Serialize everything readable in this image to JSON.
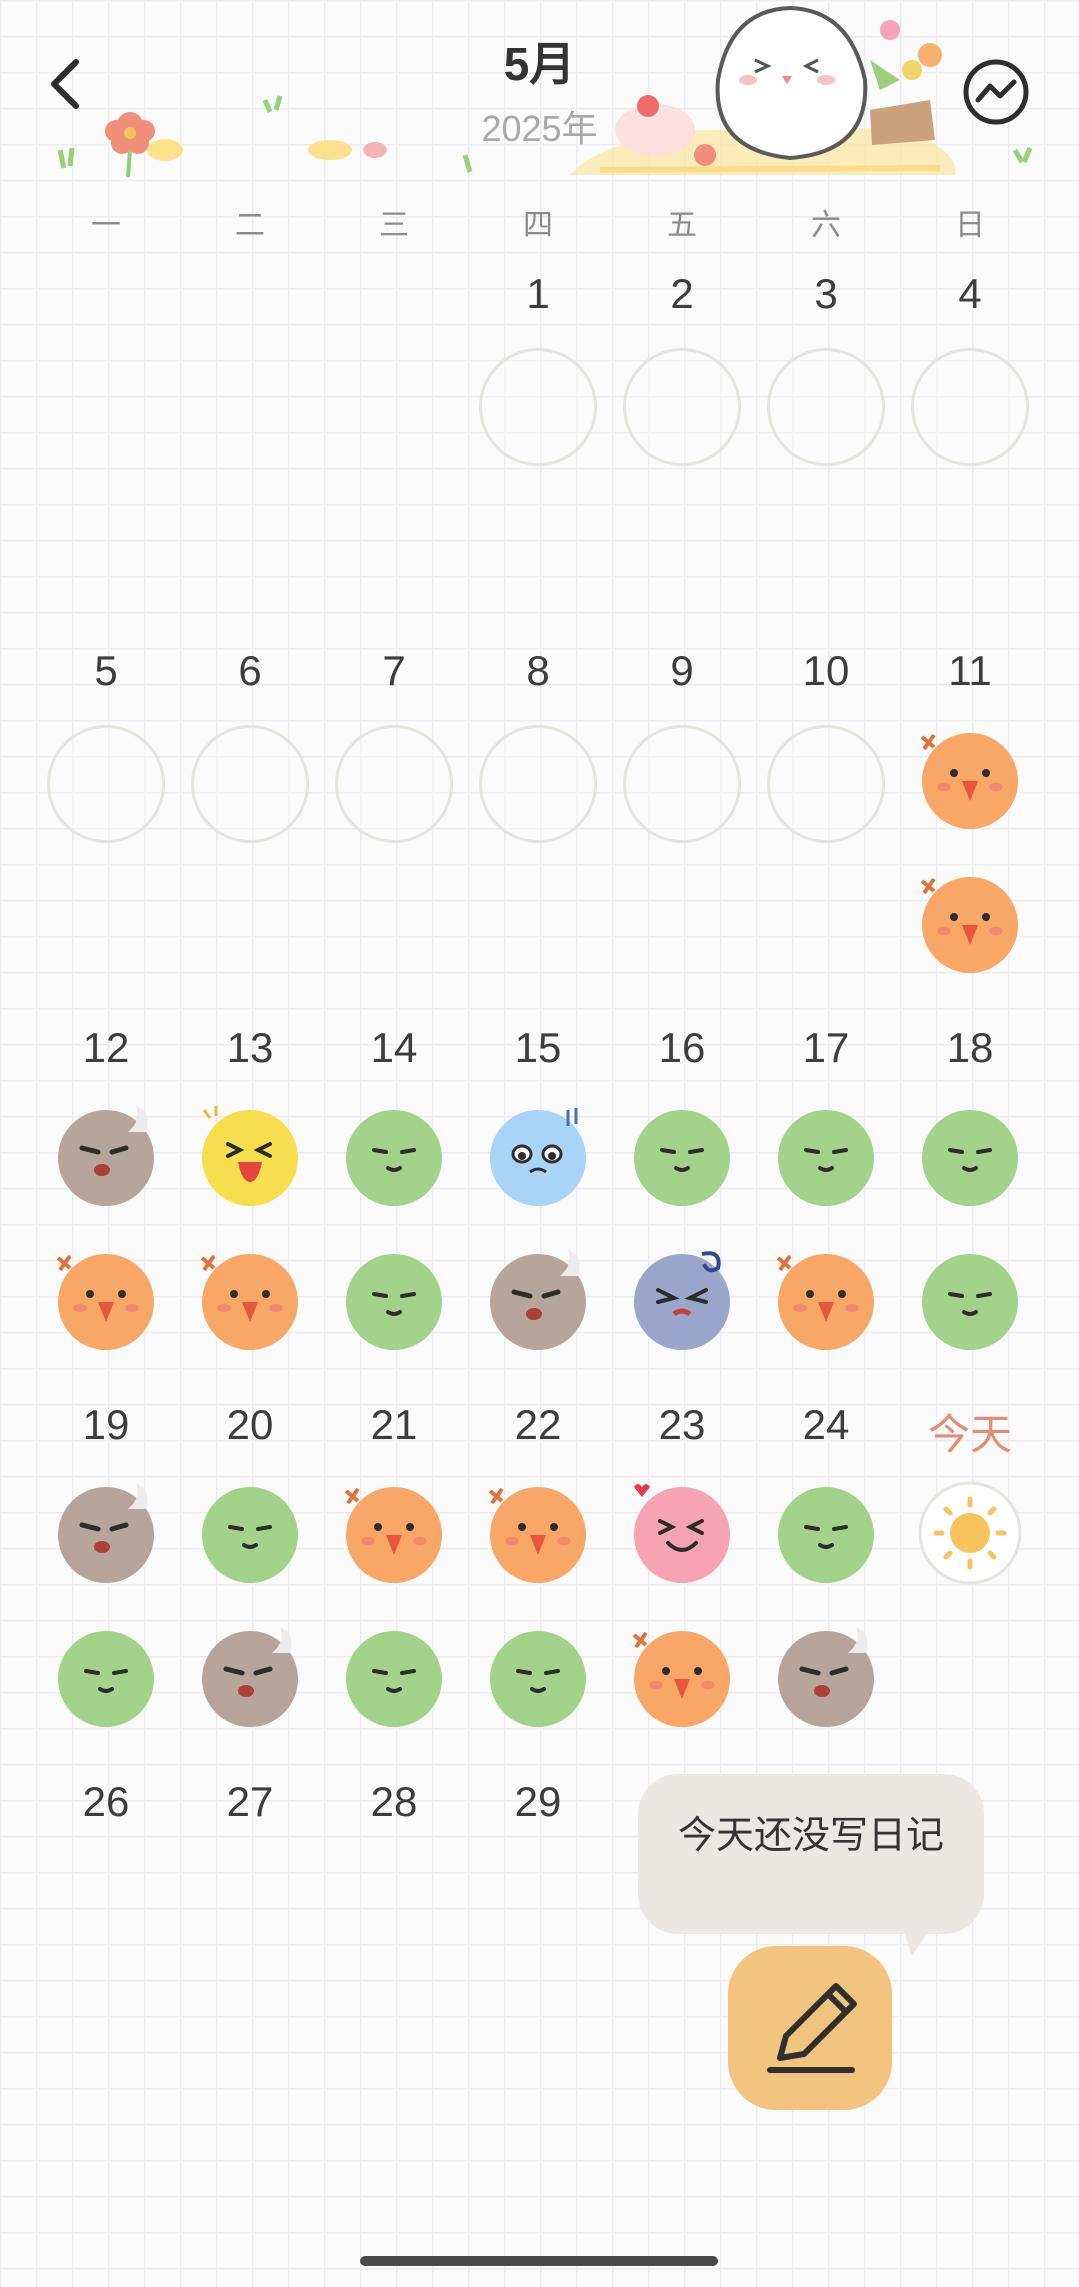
{
  "header": {
    "month": "5月",
    "year": "2025年",
    "back_icon": "chevron-left-icon",
    "trend_icon": "trend-chart-icon"
  },
  "weekdays": [
    "一",
    "二",
    "三",
    "四",
    "五",
    "六",
    "日"
  ],
  "calendar": {
    "weeks": [
      [
        {
          "label": "",
          "moods": []
        },
        {
          "label": "",
          "moods": []
        },
        {
          "label": "",
          "moods": []
        },
        {
          "label": "1",
          "moods": []
        },
        {
          "label": "2",
          "moods": []
        },
        {
          "label": "3",
          "moods": []
        },
        {
          "label": "4",
          "moods": []
        }
      ],
      [
        {
          "label": "5",
          "moods": []
        },
        {
          "label": "6",
          "moods": []
        },
        {
          "label": "7",
          "moods": []
        },
        {
          "label": "8",
          "moods": []
        },
        {
          "label": "9",
          "moods": []
        },
        {
          "label": "10",
          "moods": []
        },
        {
          "label": "11",
          "moods": [
            "angry",
            "angry"
          ]
        }
      ],
      [
        {
          "label": "12",
          "moods": [
            "tired",
            "angry"
          ]
        },
        {
          "label": "13",
          "moods": [
            "laughing",
            "angry"
          ]
        },
        {
          "label": "14",
          "moods": [
            "calm",
            "calm"
          ]
        },
        {
          "label": "15",
          "moods": [
            "sad",
            "tired"
          ]
        },
        {
          "label": "16",
          "moods": [
            "calm",
            "annoyed"
          ]
        },
        {
          "label": "17",
          "moods": [
            "calm",
            "angry"
          ]
        },
        {
          "label": "18",
          "moods": [
            "calm",
            "calm"
          ]
        }
      ],
      [
        {
          "label": "19",
          "moods": [
            "tired",
            "calm"
          ]
        },
        {
          "label": "20",
          "moods": [
            "calm",
            "tired"
          ]
        },
        {
          "label": "21",
          "moods": [
            "angry",
            "calm"
          ]
        },
        {
          "label": "22",
          "moods": [
            "angry",
            "calm"
          ]
        },
        {
          "label": "23",
          "moods": [
            "love",
            "angry"
          ]
        },
        {
          "label": "24",
          "moods": [
            "calm",
            "tired"
          ]
        },
        {
          "label": "今天",
          "moods": [
            "sunny"
          ],
          "today": true
        }
      ],
      [
        {
          "label": "26",
          "moods": []
        },
        {
          "label": "27",
          "moods": []
        },
        {
          "label": "28",
          "moods": []
        },
        {
          "label": "29",
          "moods": []
        },
        {
          "label": "",
          "moods": []
        },
        {
          "label": "",
          "moods": []
        },
        {
          "label": "",
          "moods": []
        }
      ]
    ]
  },
  "reminder": {
    "text": "今天还没写日记"
  },
  "write_button": {
    "icon": "pencil-icon"
  },
  "colors": {
    "calm": "#a3d28a",
    "angry": "#f8a766",
    "tired": "#b7a59c",
    "laughing": "#f6df4e",
    "sad": "#a9d4f7",
    "annoyed": "#9aa6cc",
    "love": "#f6a3b3",
    "today": "#e58d74",
    "button": "#f3c47f",
    "bubble": "#ebe8e3"
  }
}
